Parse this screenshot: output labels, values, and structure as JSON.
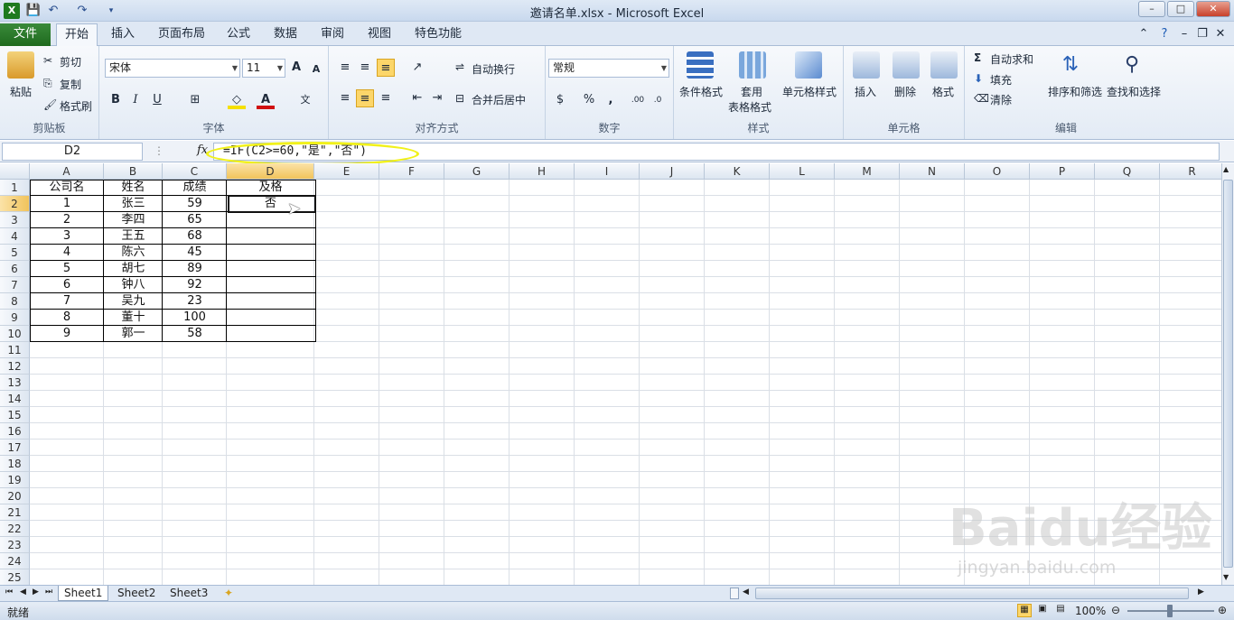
{
  "window": {
    "title": "邀请名单.xlsx - Microsoft Excel",
    "app_icon": "excel-icon",
    "controls": [
      "–",
      "□",
      "✕"
    ]
  },
  "ribbon_tabs": [
    "文件",
    "开始",
    "插入",
    "页面布局",
    "公式",
    "数据",
    "审阅",
    "视图",
    "特色功能"
  ],
  "ribbon": {
    "clipboard": {
      "paste": "粘贴",
      "cut": "剪切",
      "copy": "复制",
      "format_painter": "格式刷",
      "label": "剪贴板"
    },
    "font": {
      "name": "宋体",
      "size": "11",
      "label": "字体",
      "bold": "B",
      "italic": "I",
      "underline": "U"
    },
    "alignment": {
      "wrap": "自动换行",
      "merge": "合并后居中",
      "label": "对齐方式"
    },
    "number": {
      "format": "常规",
      "percent": "%",
      "comma": ",",
      "label": "数字"
    },
    "styles": {
      "conditional": "条件格式",
      "table_l1": "套用",
      "table_l2": "表格格式",
      "cell_styles": "单元格样式",
      "label": "样式"
    },
    "cells": {
      "insert": "插入",
      "delete": "删除",
      "format": "格式",
      "label": "单元格"
    },
    "editing": {
      "autosum": "自动求和",
      "fill": "填充",
      "clear": "清除",
      "sort": "排序和筛选",
      "find": "查找和选择",
      "label": "编辑"
    }
  },
  "formula_bar": {
    "name_box": "D2",
    "fx": "fx",
    "formula": "=IF(C2>=60,\"是\",\"否\")"
  },
  "columns": [
    "A",
    "B",
    "C",
    "D",
    "E",
    "F",
    "G",
    "H",
    "I",
    "J",
    "K",
    "L",
    "M",
    "N",
    "O",
    "P",
    "Q",
    "R"
  ],
  "rows": [
    "1",
    "2",
    "3",
    "4",
    "5",
    "6",
    "7",
    "8",
    "9",
    "10",
    "11",
    "12",
    "13",
    "14",
    "15",
    "16",
    "17",
    "18",
    "19",
    "20",
    "21",
    "22",
    "23",
    "24",
    "25"
  ],
  "table": {
    "header": [
      "公司名",
      "姓名",
      "成绩",
      "及格"
    ],
    "data": [
      [
        "1",
        "张三",
        "59",
        "否"
      ],
      [
        "2",
        "李四",
        "65",
        ""
      ],
      [
        "3",
        "王五",
        "68",
        ""
      ],
      [
        "4",
        "陈六",
        "45",
        ""
      ],
      [
        "5",
        "胡七",
        "89",
        ""
      ],
      [
        "6",
        "钟八",
        "92",
        ""
      ],
      [
        "7",
        "吴九",
        "23",
        ""
      ],
      [
        "8",
        "董十",
        "100",
        ""
      ],
      [
        "9",
        "郭一",
        "58",
        ""
      ]
    ]
  },
  "sheets": [
    "Sheet1",
    "Sheet2",
    "Sheet3"
  ],
  "status": {
    "ready": "就绪",
    "zoom": "100%"
  },
  "watermark": {
    "brand": "Baidu经验",
    "url": "jingyan.baidu.com"
  }
}
